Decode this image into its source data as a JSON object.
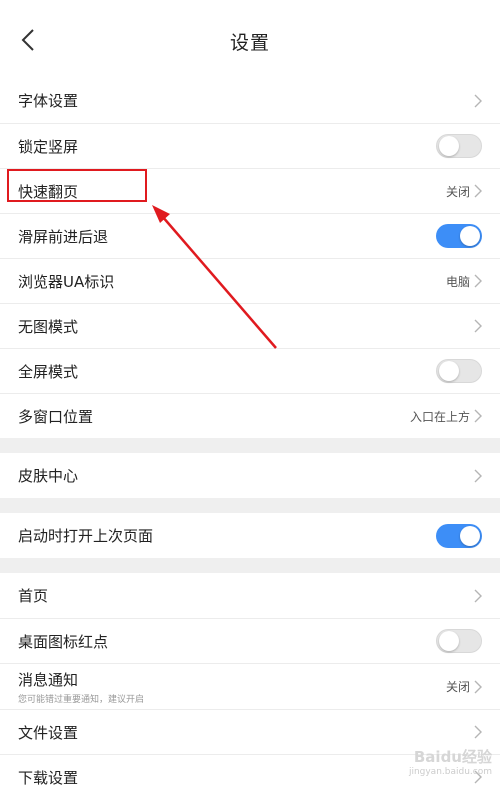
{
  "header": {
    "title": "设置"
  },
  "groups": [
    {
      "rows": [
        {
          "label": "字体设置",
          "type": "chevron"
        },
        {
          "label": "锁定竖屏",
          "type": "toggle",
          "on": false
        },
        {
          "label": "快速翻页",
          "type": "value",
          "value": "关闭"
        },
        {
          "label": "滑屏前进后退",
          "type": "toggle",
          "on": true
        },
        {
          "label": "浏览器UA标识",
          "type": "value",
          "value": "电脑"
        },
        {
          "label": "无图模式",
          "type": "chevron"
        },
        {
          "label": "全屏模式",
          "type": "toggle",
          "on": false
        },
        {
          "label": "多窗口位置",
          "type": "value",
          "value": "入口在上方"
        }
      ]
    },
    {
      "rows": [
        {
          "label": "皮肤中心",
          "type": "chevron"
        }
      ]
    },
    {
      "rows": [
        {
          "label": "启动时打开上次页面",
          "type": "toggle",
          "on": true
        }
      ]
    },
    {
      "rows": [
        {
          "label": "首页",
          "type": "chevron"
        },
        {
          "label": "桌面图标红点",
          "type": "toggle",
          "on": false
        },
        {
          "label": "消息通知",
          "sub": "您可能错过重要通知，建议开启",
          "type": "value",
          "value": "关闭"
        },
        {
          "label": "文件设置",
          "type": "chevron"
        },
        {
          "label": "下载设置",
          "type": "chevron"
        }
      ]
    }
  ],
  "watermark": {
    "brand": "Baidu经验",
    "url": "jingyan.baidu.com"
  },
  "colors": {
    "accent": "#3d8ef7",
    "annotation": "#e01a1f"
  }
}
